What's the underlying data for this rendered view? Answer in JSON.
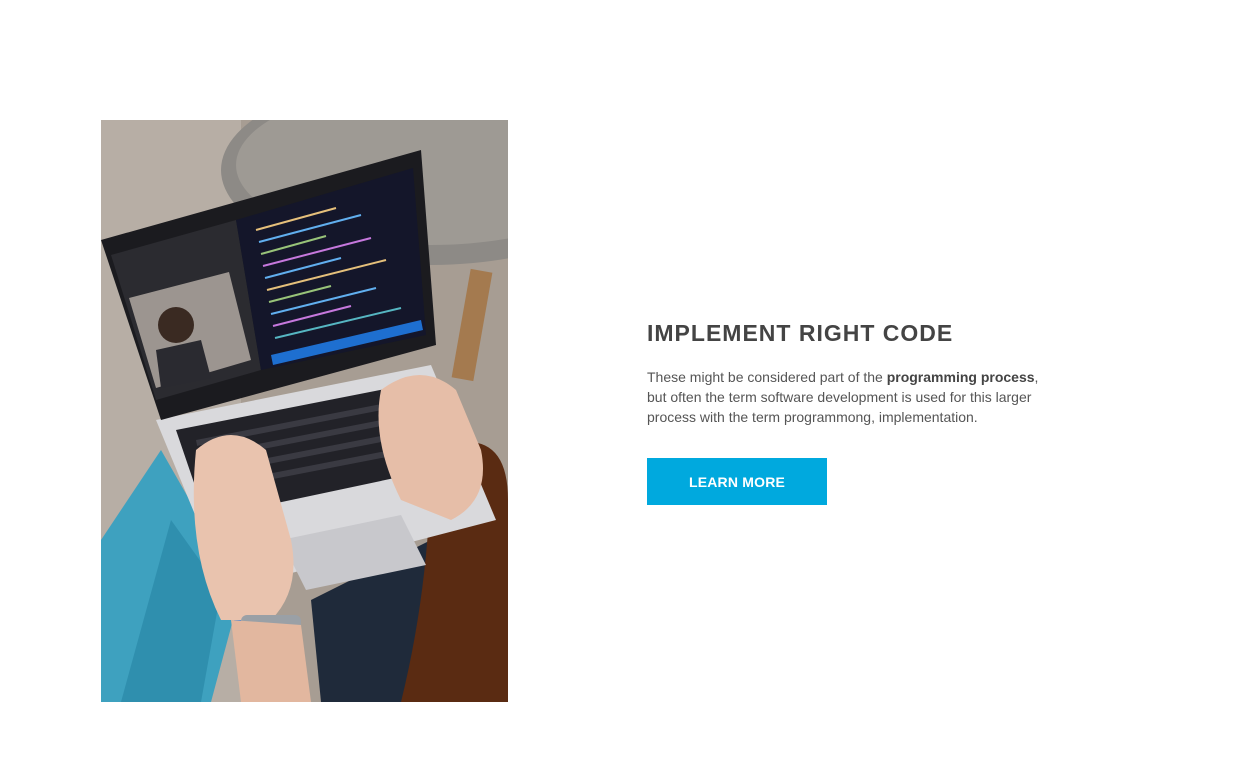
{
  "feature": {
    "image_alt": "Person typing on a laptop showing a code editor and a video call",
    "title": "IMPLEMENT RIGHT CODE",
    "text_before": "These might be considered part of the ",
    "text_bold": "programming process",
    "text_after": ", but often the term software development is used for this larger process with the term programmong, implementation.",
    "button_label": "LEARN MORE"
  },
  "colors": {
    "accent": "#00a9de",
    "heading": "#444444",
    "body_text": "#555555",
    "background": "#ffffff"
  }
}
